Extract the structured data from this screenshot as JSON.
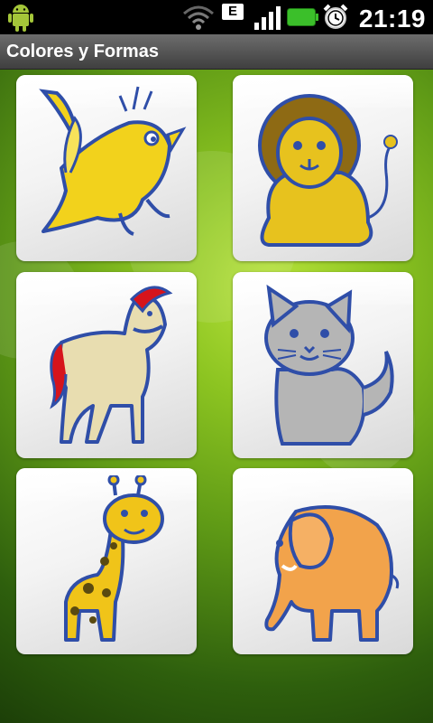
{
  "status_bar": {
    "time": "21:19",
    "network_type": "E",
    "icons": [
      "android-icon",
      "wifi-icon",
      "signal-icon",
      "battery-icon",
      "alarm-clock-icon"
    ]
  },
  "title_bar": {
    "title": "Colores y Formas"
  },
  "grid": {
    "items": [
      {
        "animal": "bird",
        "color": "#f2d21c"
      },
      {
        "animal": "lion",
        "color": "#e7c21e"
      },
      {
        "animal": "horse",
        "color": "#e8ddb0"
      },
      {
        "animal": "cat",
        "color": "#b5b5b5"
      },
      {
        "animal": "giraffe",
        "color": "#f0c419"
      },
      {
        "animal": "elephant",
        "color": "#f2a34b"
      }
    ]
  },
  "colors": {
    "outline": "#2f4ea8",
    "title_bar": "#555555",
    "background_green": "#8cc421"
  }
}
